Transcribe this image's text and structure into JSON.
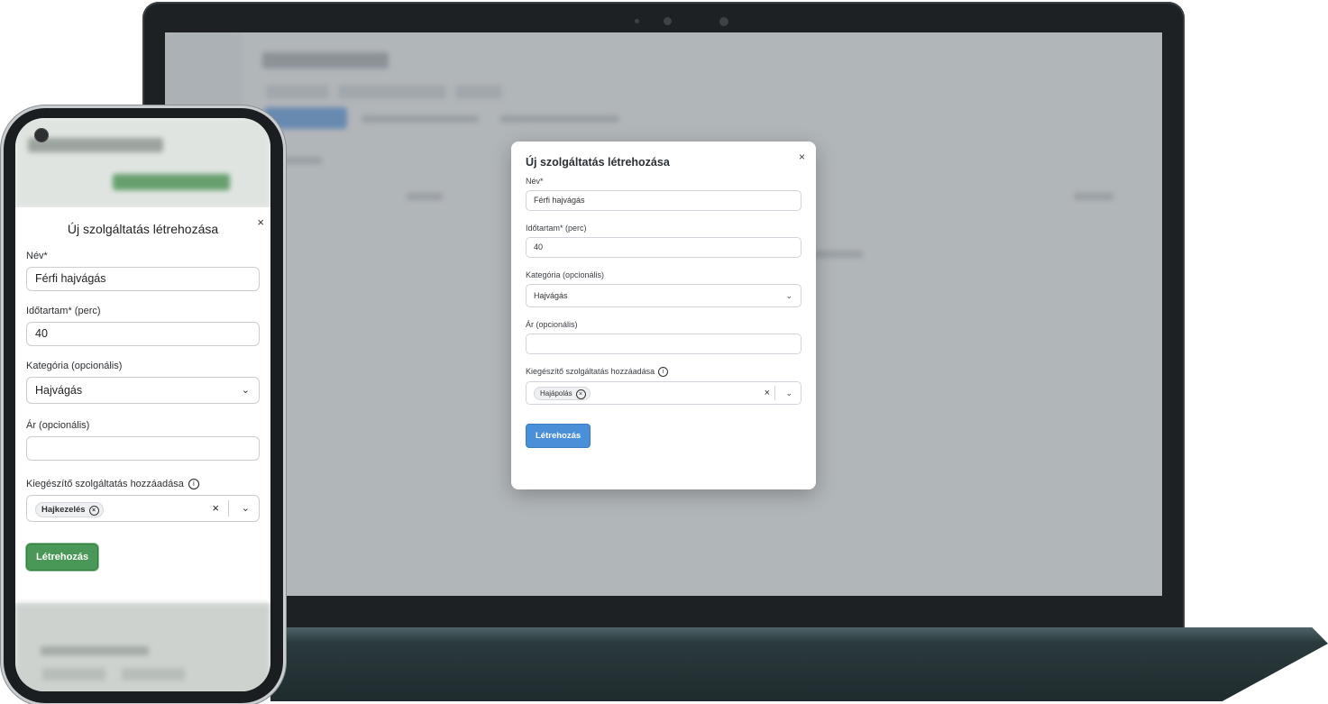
{
  "desktop": {
    "modal": {
      "title": "Új szolgáltatás létrehozása",
      "close": "×",
      "name_label": "Név*",
      "name_value": "Férfi hajvágás",
      "duration_label": "Időtartam* (perc)",
      "duration_value": "40",
      "category_label": "Kategória (opcionális)",
      "category_value": "Hajvágás",
      "price_label": "Ár (opcionális)",
      "price_value": "",
      "addon_label": "Kiegészítő szolgáltatás hozzáadása",
      "addon_chip": "Hajápolás",
      "submit": "Létrehozás",
      "accent": "#4a90d9"
    }
  },
  "mobile": {
    "modal": {
      "title": "Új szolgáltatás létrehozása",
      "close": "×",
      "name_label": "Név*",
      "name_value": "Férfi hajvágás",
      "duration_label": "Időtartam* (perc)",
      "duration_value": "40",
      "category_label": "Kategória (opcionális)",
      "category_value": "Hajvágás",
      "price_label": "Ár (opcionális)",
      "price_value": "",
      "addon_label": "Kiegészítő szolgáltatás hozzáadása",
      "addon_chip": "Hajkezelés",
      "submit": "Létrehozás",
      "accent": "#4a9857"
    }
  },
  "icons": [
    "close-icon",
    "chevron-down-icon",
    "info-icon",
    "chip-remove-icon",
    "clear-icon"
  ]
}
